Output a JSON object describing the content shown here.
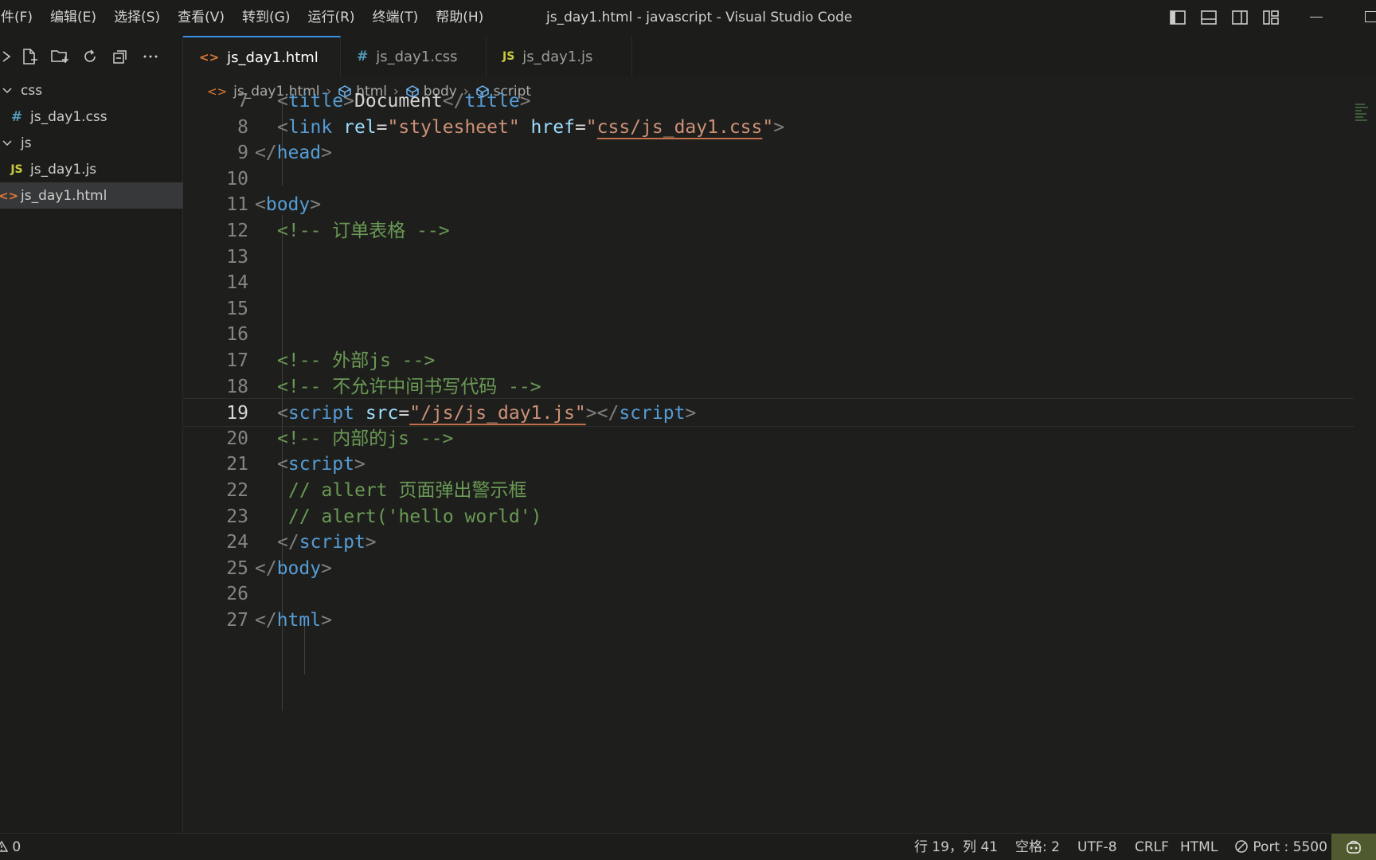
{
  "menu": {
    "items": [
      "件(F)",
      "编辑(E)",
      "选择(S)",
      "查看(V)",
      "转到(G)",
      "运行(R)",
      "终端(T)",
      "帮助(H)"
    ]
  },
  "window_title": "js_day1.html - javascript - Visual Studio Code",
  "explorer": {
    "tree": [
      {
        "label": "css",
        "type": "folder"
      },
      {
        "label": "js_day1.css",
        "type": "css",
        "badge": "#"
      },
      {
        "label": "js",
        "type": "folder"
      },
      {
        "label": "js_day1.js",
        "type": "js",
        "badge": "JS"
      },
      {
        "label": "js_day1.html",
        "type": "html",
        "badge": "<>"
      }
    ]
  },
  "tabs": [
    {
      "label": "js_day1.html",
      "badge": "<>",
      "active": true
    },
    {
      "label": "js_day1.css",
      "badge": "#"
    },
    {
      "label": "js_day1.js",
      "badge": "JS"
    }
  ],
  "breadcrumb": {
    "file": "js_day1.html",
    "items": [
      "html",
      "body",
      "script"
    ]
  },
  "editor": {
    "lines": [
      {
        "n": "7",
        "tokens": [
          [
            "br",
            "<"
          ],
          [
            "tag",
            "title"
          ],
          [
            "br",
            ">"
          ],
          [
            "txt",
            "Document"
          ],
          [
            "br",
            "</"
          ],
          [
            "tag",
            "title"
          ],
          [
            "br",
            ">"
          ]
        ]
      },
      {
        "n": "8",
        "tokens": [
          [
            "br",
            "<"
          ],
          [
            "tag",
            "link"
          ],
          [
            "txt",
            " "
          ],
          [
            "attr",
            "rel"
          ],
          [
            "txt",
            "="
          ],
          [
            "str",
            "\"stylesheet\""
          ],
          [
            "txt",
            " "
          ],
          [
            "attr",
            "href"
          ],
          [
            "txt",
            "="
          ],
          [
            "str",
            "\""
          ],
          [
            "strul",
            "css/js_day1.css"
          ],
          [
            "str",
            "\""
          ],
          [
            "br",
            ">"
          ]
        ]
      },
      {
        "n": "9",
        "tokens": [
          [
            "br",
            "</"
          ],
          [
            "tag",
            "head"
          ],
          [
            "br",
            ">"
          ]
        ]
      },
      {
        "n": "10",
        "tokens": []
      },
      {
        "n": "11",
        "tokens": [
          [
            "br",
            "<"
          ],
          [
            "tag",
            "body"
          ],
          [
            "br",
            ">"
          ]
        ]
      },
      {
        "n": "12",
        "tokens": [
          [
            "cm",
            "<!-- 订单表格 -->"
          ]
        ]
      },
      {
        "n": "13",
        "tokens": []
      },
      {
        "n": "14",
        "tokens": []
      },
      {
        "n": "15",
        "tokens": []
      },
      {
        "n": "16",
        "tokens": []
      },
      {
        "n": "17",
        "tokens": [
          [
            "cm",
            "<!-- 外部js -->"
          ]
        ]
      },
      {
        "n": "18",
        "tokens": [
          [
            "cm",
            "<!-- 不允许中间书写代码 -->"
          ]
        ]
      },
      {
        "n": "19",
        "tokens": [
          [
            "br",
            "<"
          ],
          [
            "tag",
            "script"
          ],
          [
            "txt",
            " "
          ],
          [
            "attr",
            "src"
          ],
          [
            "txt",
            "="
          ],
          [
            "strul",
            "\"/js/js_day1.js\""
          ],
          [
            "br",
            "></"
          ],
          [
            "tag",
            "script"
          ],
          [
            "br",
            ">"
          ]
        ]
      },
      {
        "n": "20",
        "tokens": [
          [
            "cm",
            "<!-- 内部的js -->"
          ]
        ]
      },
      {
        "n": "21",
        "tokens": [
          [
            "br",
            "<"
          ],
          [
            "tag",
            "script"
          ],
          [
            "br",
            ">"
          ]
        ]
      },
      {
        "n": "22",
        "tokens": [
          [
            "cm",
            "// allert 页面弹出警示框"
          ]
        ]
      },
      {
        "n": "23",
        "tokens": [
          [
            "cm",
            "// alert('hello world')"
          ]
        ]
      },
      {
        "n": "24",
        "tokens": [
          [
            "br",
            "</"
          ],
          [
            "tag",
            "script"
          ],
          [
            "br",
            ">"
          ]
        ]
      },
      {
        "n": "25",
        "tokens": [
          [
            "br",
            "</"
          ],
          [
            "tag",
            "body"
          ],
          [
            "br",
            ">"
          ]
        ]
      },
      {
        "n": "26",
        "tokens": []
      },
      {
        "n": "27",
        "tokens": [
          [
            "br",
            "</"
          ],
          [
            "tag",
            "html"
          ],
          [
            "br",
            ">"
          ]
        ]
      }
    ],
    "current_line": "19"
  },
  "status": {
    "problems": "0",
    "position": "行 19，列 41",
    "spaces": "空格: 2",
    "encoding": "UTF-8",
    "eol": "CRLF",
    "language": "HTML",
    "port": "Port : 5500"
  },
  "colors": {
    "accent": "#3a8ee6",
    "comment": "#6a9955",
    "tag": "#569cd6",
    "attr": "#9cdcfe",
    "string": "#ce9178"
  }
}
